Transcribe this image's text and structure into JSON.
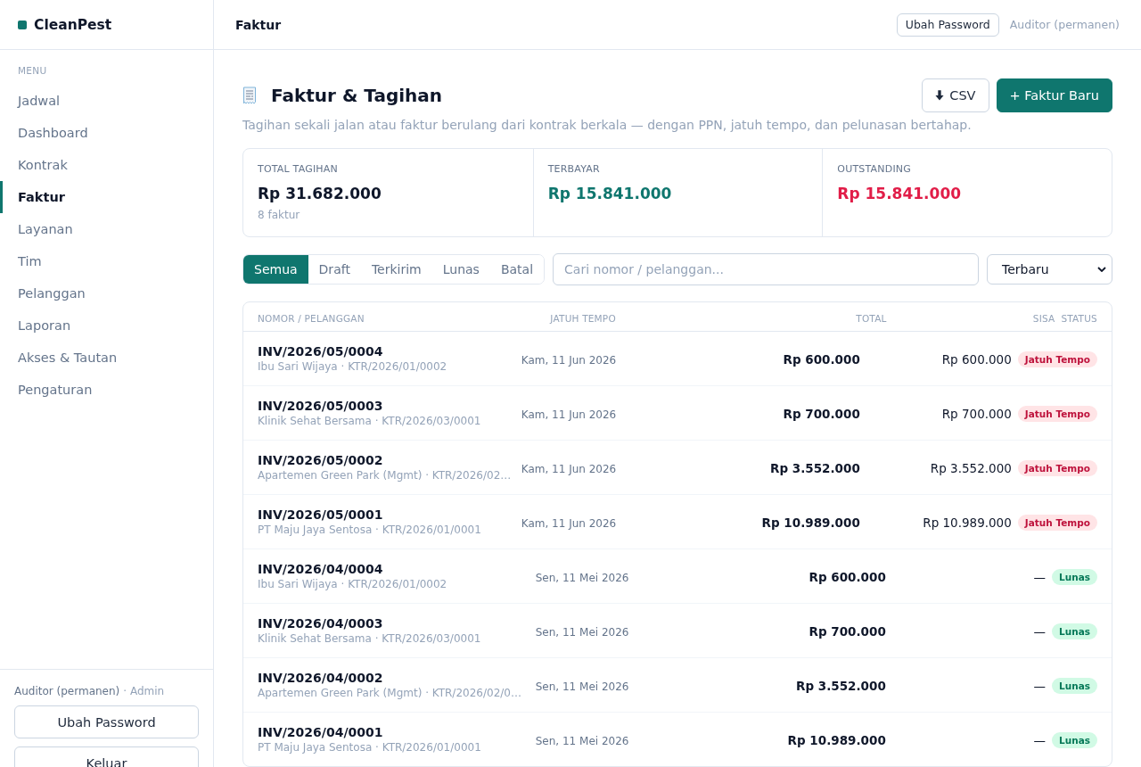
{
  "sidebar": {
    "brand": "CleanPest",
    "menu_label": "MENU",
    "items": [
      {
        "label": "Jadwal",
        "selected": false
      },
      {
        "label": "Dashboard",
        "selected": false
      },
      {
        "label": "Kontrak",
        "selected": false
      },
      {
        "label": "Faktur",
        "selected": true
      },
      {
        "label": "Layanan",
        "selected": false
      },
      {
        "label": "Tim",
        "selected": false
      },
      {
        "label": "Pelanggan",
        "selected": false
      },
      {
        "label": "Laporan",
        "selected": false
      },
      {
        "label": "Akses & Tautan",
        "selected": false
      },
      {
        "label": "Pengaturan",
        "selected": false
      }
    ],
    "user": "Auditor (permanen)",
    "role": "· Admin",
    "buttons": [
      "Ubah Password",
      "Keluar"
    ]
  },
  "topbar": {
    "title": "Faktur",
    "button": "Ubah Password",
    "user": "Auditor (permanen)"
  },
  "page": {
    "title": "Faktur & Tagihan",
    "description": "Tagihan sekali jalan atau faktur berulang dari kontrak berkala — dengan PPN, jatuh tempo, dan pelunasan bertahap.",
    "buttons": [
      {
        "label": "CSV",
        "kind": "export"
      },
      {
        "label": "+ Faktur Baru",
        "kind": "create"
      }
    ]
  },
  "stats": [
    {
      "label": "TOTAL TAGIHAN",
      "value": "Rp 31.682.000",
      "note": "8 faktur",
      "color": "#0f172a"
    },
    {
      "label": "TERBAYAR",
      "value": "Rp 15.841.000",
      "color": "#0f766e"
    },
    {
      "label": "OUTSTANDING",
      "value": "Rp 15.841.000",
      "color": "#e11d48"
    }
  ],
  "filters": {
    "tabs": [
      {
        "label": "Semua",
        "selected": true
      },
      {
        "label": "Draft",
        "selected": false
      },
      {
        "label": "Terkirim",
        "selected": false
      },
      {
        "label": "Lunas",
        "selected": false
      },
      {
        "label": "Batal",
        "selected": false
      }
    ],
    "search": {
      "placeholder": "Cari nomor / pelanggan..."
    },
    "sort": "Terbaru"
  },
  "table": {
    "columns": [
      "NOMOR / PELANGGAN",
      "JATUH TEMPO",
      "TOTAL",
      "SISA",
      "STATUS"
    ],
    "rows": [
      {
        "number": "INV/2026/05/0004",
        "customer": "Ibu Sari Wijaya · KTR/2026/01/0002",
        "due": "Kam, 11 Jun 2026",
        "total": "Rp 600.000",
        "remaining": "Rp 600.000",
        "status": {
          "label": "Jatuh Tempo",
          "kind": "overdue"
        }
      },
      {
        "number": "INV/2026/05/0003",
        "customer": "Klinik Sehat Bersama · KTR/2026/03/0001",
        "due": "Kam, 11 Jun 2026",
        "total": "Rp 700.000",
        "remaining": "Rp 700.000",
        "status": {
          "label": "Jatuh Tempo",
          "kind": "overdue"
        }
      },
      {
        "number": "INV/2026/05/0002",
        "customer": "Apartemen Green Park (Mgmt) · KTR/2026/02…",
        "due": "Kam, 11 Jun 2026",
        "total": "Rp 3.552.000",
        "remaining": "Rp 3.552.000",
        "status": {
          "label": "Jatuh Tempo",
          "kind": "overdue"
        }
      },
      {
        "number": "INV/2026/05/0001",
        "customer": "PT Maju Jaya Sentosa · KTR/2026/01/0001",
        "due": "Kam, 11 Jun 2026",
        "total": "Rp 10.989.000",
        "remaining": "Rp 10.989.000",
        "status": {
          "label": "Jatuh Tempo",
          "kind": "overdue"
        }
      },
      {
        "number": "INV/2026/04/0004",
        "customer": "Ibu Sari Wijaya · KTR/2026/01/0002",
        "due": "Sen, 11 Mei 2026",
        "total": "Rp 600.000",
        "remaining": "—",
        "status": {
          "label": "Lunas",
          "kind": "paid"
        }
      },
      {
        "number": "INV/2026/04/0003",
        "customer": "Klinik Sehat Bersama · KTR/2026/03/0001",
        "due": "Sen, 11 Mei 2026",
        "total": "Rp 700.000",
        "remaining": "—",
        "status": {
          "label": "Lunas",
          "kind": "paid"
        }
      },
      {
        "number": "INV/2026/04/0002",
        "customer": "Apartemen Green Park (Mgmt) · KTR/2026/02/0…",
        "due": "Sen, 11 Mei 2026",
        "total": "Rp 3.552.000",
        "remaining": "—",
        "status": {
          "label": "Lunas",
          "kind": "paid"
        }
      },
      {
        "number": "INV/2026/04/0001",
        "customer": "PT Maju Jaya Sentosa · KTR/2026/01/0001",
        "due": "Sen, 11 Mei 2026",
        "total": "Rp 10.989.000",
        "remaining": "—",
        "status": {
          "label": "Lunas",
          "kind": "paid"
        }
      }
    ]
  }
}
